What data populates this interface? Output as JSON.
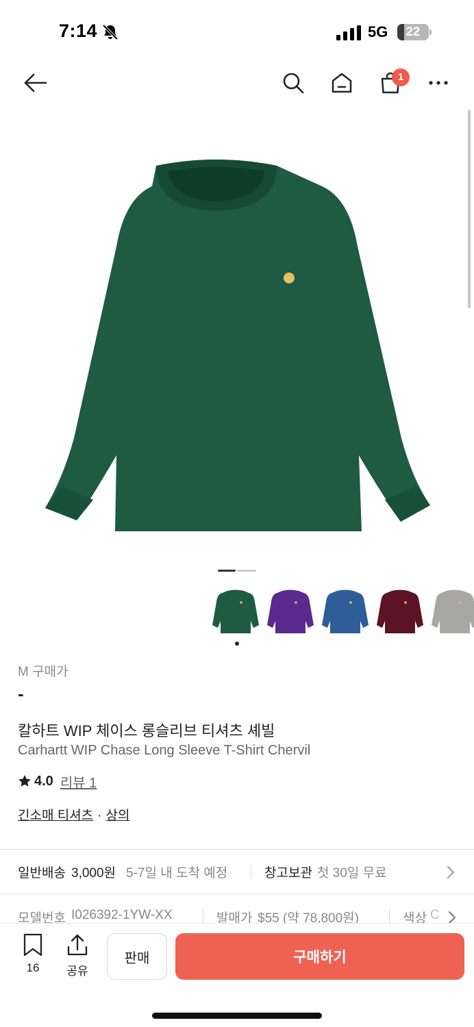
{
  "status_bar": {
    "time": "7:14",
    "network": "5G",
    "battery_level": "22",
    "battery_fraction": 0.22
  },
  "nav": {
    "cart_count": "1",
    "icons": [
      "back-arrow-icon",
      "search-icon",
      "home-icon",
      "cart-icon",
      "more-icon"
    ]
  },
  "product": {
    "image_color": "#1f5a42",
    "logo_color": "#e2c266",
    "carousel_page": 1,
    "carousel_pages": 2,
    "color_options": [
      {
        "name": "green",
        "hex": "#1f5a42",
        "selected": true
      },
      {
        "name": "purple",
        "hex": "#5b2a8e"
      },
      {
        "name": "blue",
        "hex": "#2e5d99"
      },
      {
        "name": "burgundy",
        "hex": "#5a1424"
      },
      {
        "name": "grey",
        "hex": "#a7a7a5"
      }
    ],
    "price_label": "M 구매가",
    "price_value": "-",
    "title_kr": "칼하트 WIP 체이스 롱슬리브 티셔츠 셰빌",
    "title_en": "Carhartt WIP Chase Long Sleeve T-Shirt Chervil",
    "rating": "4.0",
    "review_label": "리뷰 1",
    "category_1": "긴소매 티셔츠",
    "category_sep": "·",
    "category_2": "상의"
  },
  "delivery": {
    "standard_label": "일반배송",
    "standard_price": "3,000원",
    "standard_eta": "5-7일 내 도착 예정",
    "storage_label": "창고보관",
    "storage_note": "첫 30일 무료"
  },
  "specs": {
    "model_label": "모델번호",
    "model_value": "I026392-1YW-XX",
    "release_label": "발매가",
    "release_value": "$55 (약 78,800원)",
    "color_label": "색상",
    "color_value": "C"
  },
  "bottom_bar": {
    "bookmark_count": "16",
    "share_label": "공유",
    "sell_label": "판매",
    "buy_label": "구매하기",
    "buy_color": "#ef6253"
  }
}
